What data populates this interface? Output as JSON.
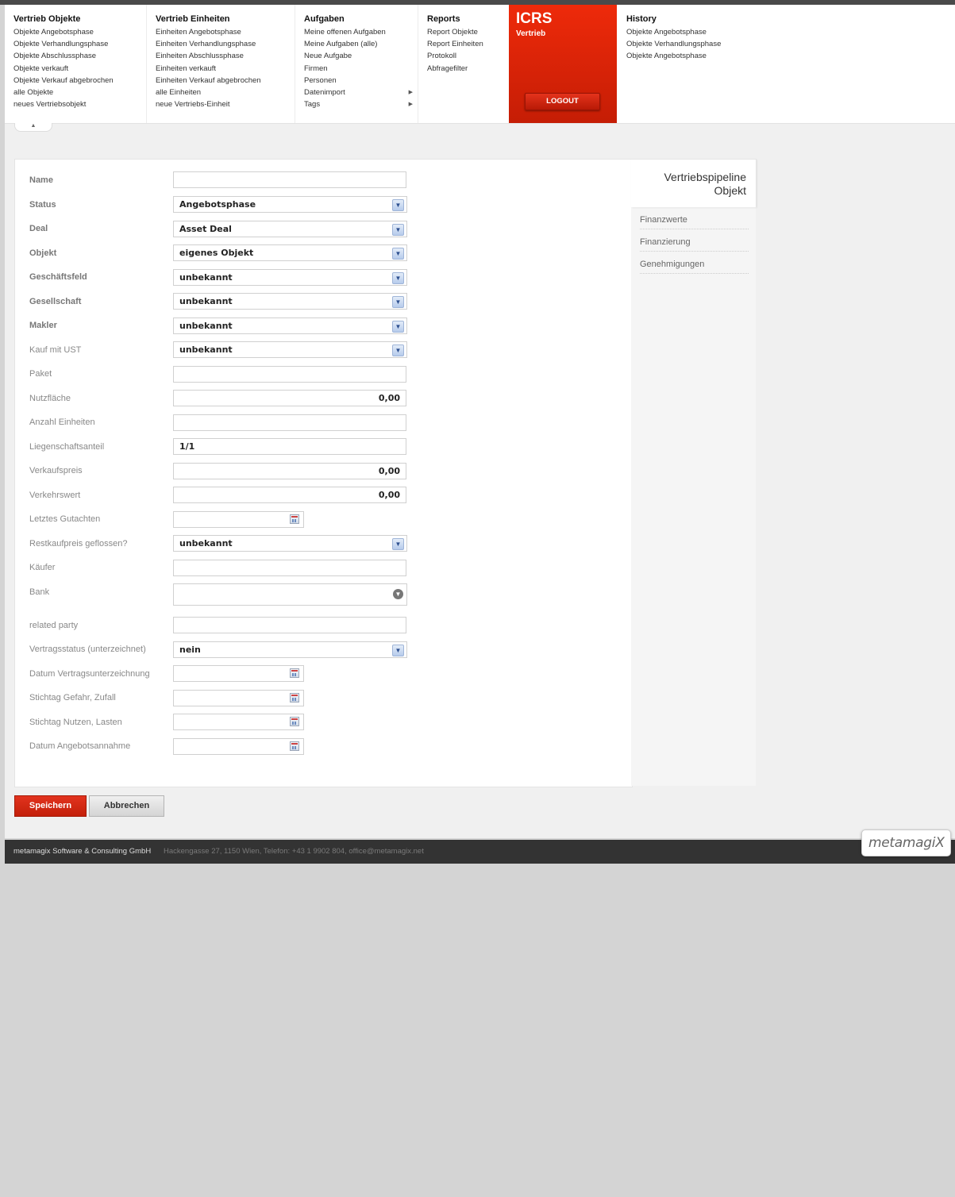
{
  "menu": {
    "objekte": {
      "title": "Vertrieb Objekte",
      "items": [
        "Objekte Angebotsphase",
        "Objekte Verhandlungsphase",
        "Objekte Abschlussphase",
        "Objekte verkauft",
        "Objekte Verkauf abgebrochen",
        "alle Objekte",
        "neues Vertriebsobjekt"
      ]
    },
    "einheiten": {
      "title": "Vertrieb Einheiten",
      "items": [
        "Einheiten Angebotsphase",
        "Einheiten Verhandlungsphase",
        "Einheiten Abschlussphase",
        "Einheiten verkauft",
        "Einheiten Verkauf abgebrochen",
        "alle Einheiten",
        "neue Vertriebs-Einheit"
      ]
    },
    "aufgaben": {
      "title": "Aufgaben",
      "items": [
        "Meine offenen Aufgaben",
        "Meine Aufgaben (alle)",
        "Neue Aufgabe",
        "Firmen",
        "Personen",
        "Datenimport",
        "Tags"
      ]
    },
    "reports": {
      "title": "Reports",
      "items": [
        "Report Objekte",
        "Report Einheiten",
        "Protokoll",
        "Abfragefilter"
      ]
    },
    "brand": {
      "title": "ICRS",
      "subtitle": "Vertrieb",
      "logout": "LOGOUT"
    },
    "history": {
      "title": "History",
      "items": [
        "Objekte Angebotsphase",
        "Objekte Verhandlungsphase",
        "Objekte Angebotsphase"
      ]
    }
  },
  "form": {
    "name": {
      "label": "Name",
      "value": ""
    },
    "status": {
      "label": "Status",
      "value": "Angebotsphase"
    },
    "deal": {
      "label": "Deal",
      "value": "Asset Deal"
    },
    "objekt": {
      "label": "Objekt",
      "value": "eigenes Objekt"
    },
    "geschaeftsfeld": {
      "label": "Geschäftsfeld",
      "value": "unbekannt"
    },
    "gesellschaft": {
      "label": "Gesellschaft",
      "value": "unbekannt"
    },
    "makler": {
      "label": "Makler",
      "value": "unbekannt"
    },
    "kauf_mit_ust": {
      "label": "Kauf mit UST",
      "value": "unbekannt"
    },
    "paket": {
      "label": "Paket",
      "value": ""
    },
    "nutzflaeche": {
      "label": "Nutzfläche",
      "value": "0,00"
    },
    "anzahl_einheiten": {
      "label": "Anzahl Einheiten",
      "value": ""
    },
    "liegenschaftsanteil": {
      "label": "Liegenschaftsanteil",
      "value": "1/1"
    },
    "verkaufspreis": {
      "label": "Verkaufspreis",
      "value": "0,00"
    },
    "verkehrswert": {
      "label": "Verkehrswert",
      "value": "0,00"
    },
    "letztes_gutachten": {
      "label": "Letztes Gutachten",
      "value": ""
    },
    "restkaufpreis": {
      "label": "Restkaufpreis geflossen?",
      "value": "unbekannt"
    },
    "kaeufer": {
      "label": "Käufer",
      "value": ""
    },
    "bank": {
      "label": "Bank",
      "value": ""
    },
    "related_party": {
      "label": "related party",
      "value": ""
    },
    "vertragsstatus": {
      "label": "Vertragsstatus (unterzeichnet)",
      "value": "nein"
    },
    "datum_vertrag": {
      "label": "Datum Vertragsunterzeichnung",
      "value": ""
    },
    "stichtag_gefahr": {
      "label": "Stichtag Gefahr, Zufall",
      "value": ""
    },
    "stichtag_nutzen": {
      "label": "Stichtag Nutzen, Lasten",
      "value": ""
    },
    "datum_angebot": {
      "label": "Datum Angebotsannahme",
      "value": ""
    }
  },
  "sidebar": {
    "tab_line1": "Vertriebspipeline",
    "tab_line2": "Objekt",
    "links": [
      "Finanzwerte",
      "Finanzierung",
      "Genehmigungen"
    ]
  },
  "buttons": {
    "save": "Speichern",
    "cancel": "Abbrechen"
  },
  "footer": {
    "company": "metamagix Software & Consulting GmbH",
    "address": "Hackengasse 27, 1150 Wien, Telefon: +43 1 9902 804, office@metamagix.net",
    "logo": "metamagiX"
  },
  "colors": {
    "brand_red": "#e3270d",
    "footer_bg": "#333333",
    "page_bg": "#d4d4d4"
  },
  "icons": [
    "collapse-arrow-icon",
    "submenu-arrow-icon",
    "dropdown-arrow-icon",
    "calendar-icon"
  ]
}
